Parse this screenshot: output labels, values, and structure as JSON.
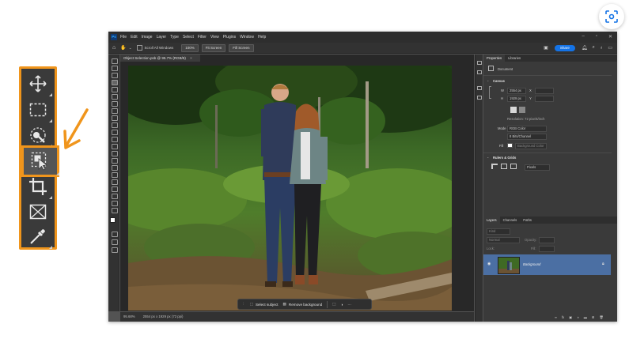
{
  "colors": {
    "accent_orange": "#f0951c",
    "ps_blue": "#1473e6",
    "layer_select": "#4b6fa3"
  },
  "toolbar_icons": [
    "move-icon",
    "marquee-icon",
    "quick-selection-icon",
    "object-selection-icon",
    "crop-icon",
    "frame-icon",
    "eyedropper-icon"
  ],
  "menu": [
    "File",
    "Edit",
    "Image",
    "Layer",
    "Type",
    "Select",
    "Filter",
    "View",
    "Plugins",
    "Window",
    "Help"
  ],
  "options": {
    "scroll_all": "Scroll All Windows",
    "zoom_pct": "100%",
    "fit_screen": "Fit Screen",
    "fill_screen": "Fill Screen",
    "share": "Share"
  },
  "document": {
    "tab": "Object Selection.psb @ 95.7% (RGB/8)",
    "status_zoom": "95.68%",
    "status_size": "2554 px x 1929 px (72 ppi)"
  },
  "context_bar": {
    "select_subject": "Select subject",
    "remove_background": "Remove background"
  },
  "properties": {
    "tabs": [
      "Properties",
      "Libraries"
    ],
    "doc_label": "Document",
    "canvas_heading": "Canvas",
    "w_label": "W",
    "w_value": "2554 px",
    "h_label": "H",
    "h_value": "1929 px",
    "x_label": "X",
    "y_label": "Y",
    "resolution": "Resolution: 72 pixels/inch",
    "mode_label": "Mode",
    "mode_value": "RGB Color",
    "depth_value": "8 Bits/Channel",
    "fill_label": "Fill",
    "fill_value": "Background Color",
    "rulers_heading": "Rulers & Grids",
    "units_value": "Pixels"
  },
  "layers": {
    "tabs": [
      "Layers",
      "Channels",
      "Paths"
    ],
    "kind": "Kind",
    "normal": "Normal",
    "opacity": "Opacity:",
    "lock": "Lock:",
    "fill": "Fill:",
    "layer_name": "Background"
  }
}
